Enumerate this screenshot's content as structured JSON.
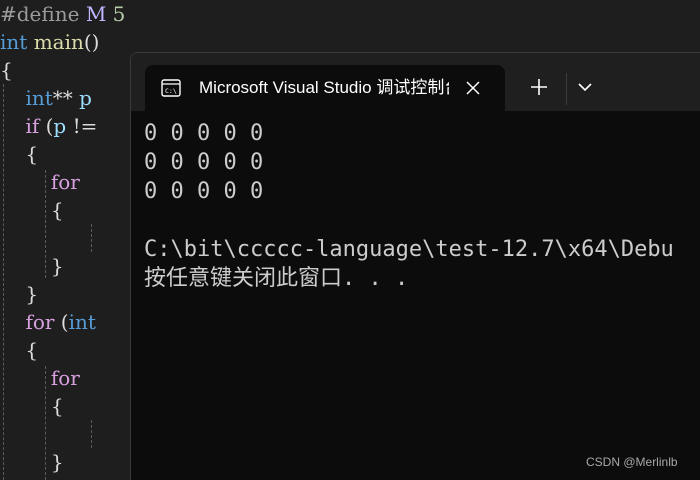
{
  "editor": {
    "lines": [
      {
        "tokens": [
          {
            "t": "#define ",
            "c": "pre"
          },
          {
            "t": "M",
            "c": "mac"
          },
          {
            "t": " ",
            "c": "txt"
          },
          {
            "t": "5",
            "c": "num"
          }
        ]
      },
      {
        "tokens": [
          {
            "t": "int",
            "c": "kw"
          },
          {
            "t": " ",
            "c": "txt"
          },
          {
            "t": "main",
            "c": "fn"
          },
          {
            "t": "()",
            "c": "txt"
          }
        ]
      },
      {
        "tokens": [
          {
            "t": "{",
            "c": "txt"
          }
        ]
      },
      {
        "tokens": [
          {
            "t": "    ",
            "c": "txt"
          },
          {
            "t": "int",
            "c": "kw"
          },
          {
            "t": "** ",
            "c": "txt"
          },
          {
            "t": "p",
            "c": "var"
          }
        ]
      },
      {
        "tokens": [
          {
            "t": "    ",
            "c": "txt"
          },
          {
            "t": "if",
            "c": "ctl"
          },
          {
            "t": " (",
            "c": "txt"
          },
          {
            "t": "p",
            "c": "var"
          },
          {
            "t": " !=",
            "c": "txt"
          }
        ]
      },
      {
        "tokens": [
          {
            "t": "    {",
            "c": "txt"
          }
        ]
      },
      {
        "tokens": [
          {
            "t": "        ",
            "c": "txt"
          },
          {
            "t": "for",
            "c": "ctl"
          }
        ]
      },
      {
        "tokens": [
          {
            "t": "        {",
            "c": "txt"
          }
        ]
      },
      {
        "tokens": [
          {
            "t": "",
            "c": "txt"
          }
        ]
      },
      {
        "tokens": [
          {
            "t": "        }",
            "c": "txt"
          }
        ]
      },
      {
        "tokens": [
          {
            "t": "    }",
            "c": "txt"
          }
        ]
      },
      {
        "tokens": [
          {
            "t": "    ",
            "c": "txt"
          },
          {
            "t": "for",
            "c": "ctl"
          },
          {
            "t": " (",
            "c": "txt"
          },
          {
            "t": "int",
            "c": "kw"
          }
        ]
      },
      {
        "tokens": [
          {
            "t": "    {",
            "c": "txt"
          }
        ]
      },
      {
        "tokens": [
          {
            "t": "        ",
            "c": "txt"
          },
          {
            "t": "for",
            "c": "ctl"
          }
        ]
      },
      {
        "tokens": [
          {
            "t": "        {",
            "c": "txt"
          }
        ]
      },
      {
        "tokens": [
          {
            "t": "",
            "c": "txt"
          }
        ]
      },
      {
        "tokens": [
          {
            "t": "        }",
            "c": "txt"
          }
        ]
      }
    ]
  },
  "terminal": {
    "tab_title": "Microsoft Visual Studio 调试控制台",
    "tab_icon": "console-app-icon",
    "close_icon": "close-icon",
    "new_tab_icon": "plus-icon",
    "dropdown_icon": "chevron-down-icon",
    "output": [
      "0 0 0 0 0",
      "0 0 0 0 0",
      "0 0 0 0 0",
      "",
      "C:\\bit\\ccccc-language\\test-12.7\\x64\\Debu",
      "按任意键关闭此窗口. . ."
    ]
  },
  "watermark": "CSDN @Merlinlb",
  "colors": {
    "editor_bg": "#1e1e1e",
    "terminal_bg": "#0c0c0c",
    "titlebar_bg": "#1f1f1f",
    "text": "#cccccc",
    "keyword": "#569cd6",
    "control_keyword": "#d8a0df",
    "function": "#dcdcaa",
    "number": "#b5cea8"
  }
}
